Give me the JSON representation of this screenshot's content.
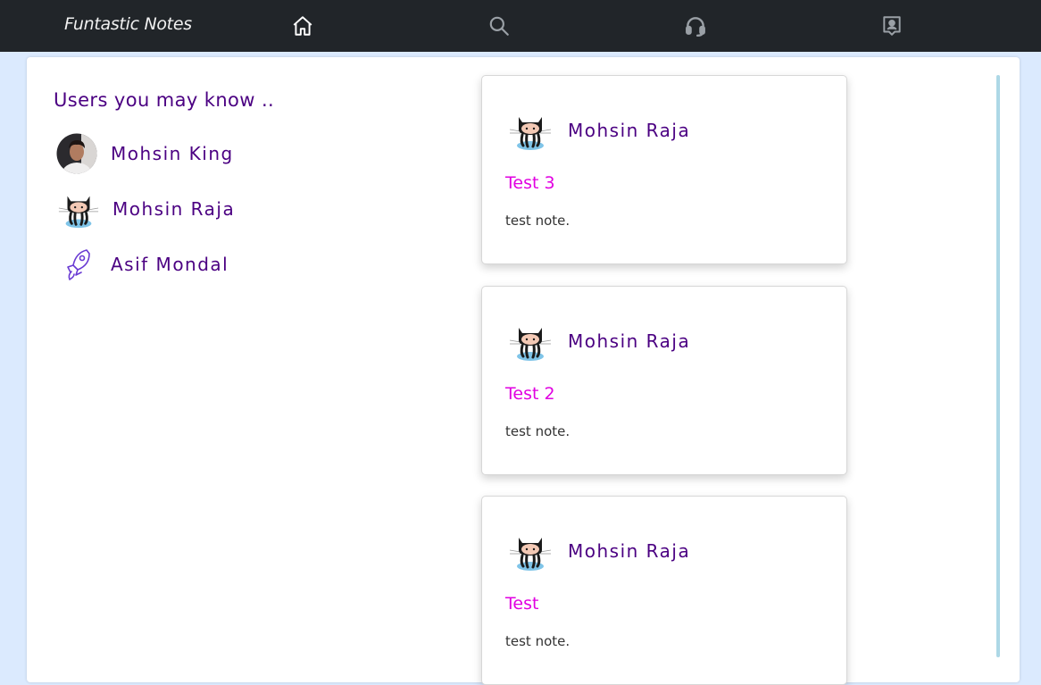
{
  "nav": {
    "brand": "Funtastic Notes",
    "icons": [
      "home-icon",
      "search-icon",
      "headset-icon",
      "contact-icon"
    ]
  },
  "colors": {
    "navbar": "#212529",
    "background": "#dbeafe",
    "accent": "#4b0082",
    "note_title": "#e100e1",
    "scrollbar": "#add8e6"
  },
  "sidebar": {
    "title": "Users you may know ..",
    "users": [
      {
        "name": "Mohsin King",
        "avatar": "photo-avatar"
      },
      {
        "name": "Mohsin Raja",
        "avatar": "octocat-avatar"
      },
      {
        "name": "Asif Mondal",
        "avatar": "rocket-avatar"
      }
    ]
  },
  "notes": [
    {
      "author": "Mohsin Raja",
      "title": "Test 3",
      "body": "test note."
    },
    {
      "author": "Mohsin Raja",
      "title": "Test 2",
      "body": "test note."
    },
    {
      "author": "Mohsin Raja",
      "title": "Test",
      "body": "test note."
    }
  ]
}
